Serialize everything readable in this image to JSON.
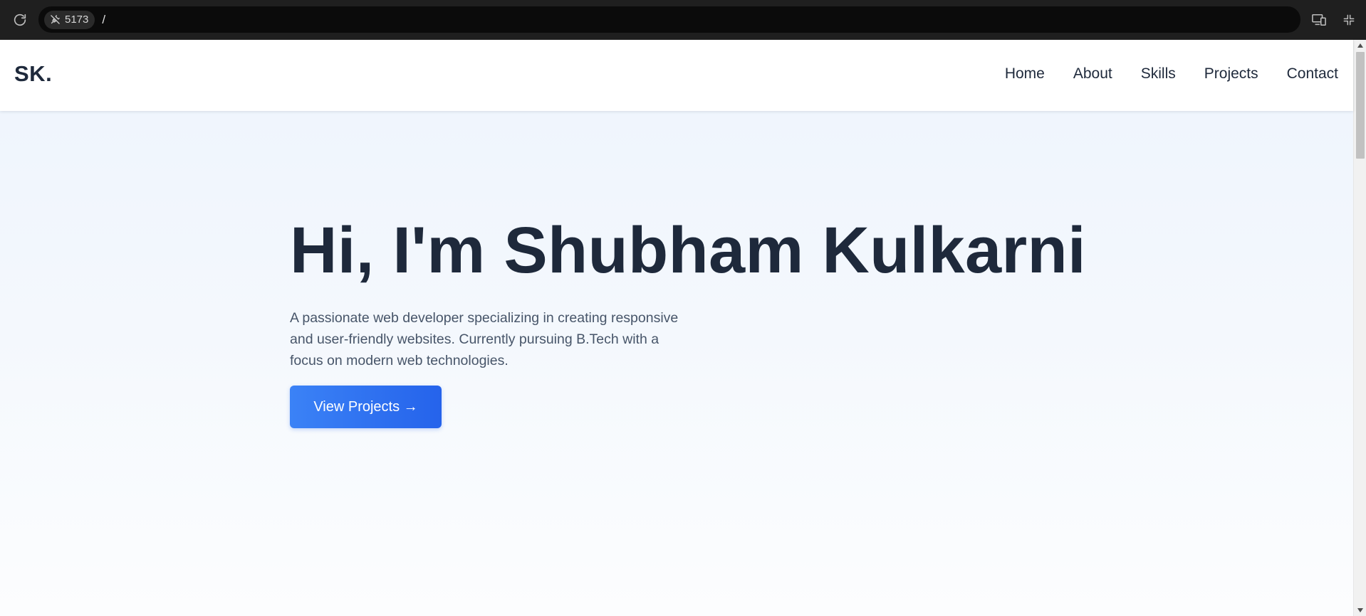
{
  "browser": {
    "port": "5173",
    "path": "/"
  },
  "navbar": {
    "logo": "SK.",
    "links": [
      "Home",
      "About",
      "Skills",
      "Projects",
      "Contact"
    ]
  },
  "hero": {
    "title": "Hi, I'm Shubham Kulkarni",
    "description": "A passionate web developer specializing in creating responsive and user-friendly websites. Currently pursuing B.Tech with a focus on modern web technologies.",
    "cta_label": "View Projects →"
  },
  "icons": {
    "reload": "reload-icon",
    "port_status": "plug-disconnected-icon",
    "device_toggle": "devices-icon",
    "collapse": "collapse-icon"
  },
  "colors": {
    "accent": "#2563eb",
    "accent_light": "#3b82f6",
    "text_dark": "#1e293b",
    "text_muted": "#475569",
    "toolbar": "#1f1f1f"
  }
}
